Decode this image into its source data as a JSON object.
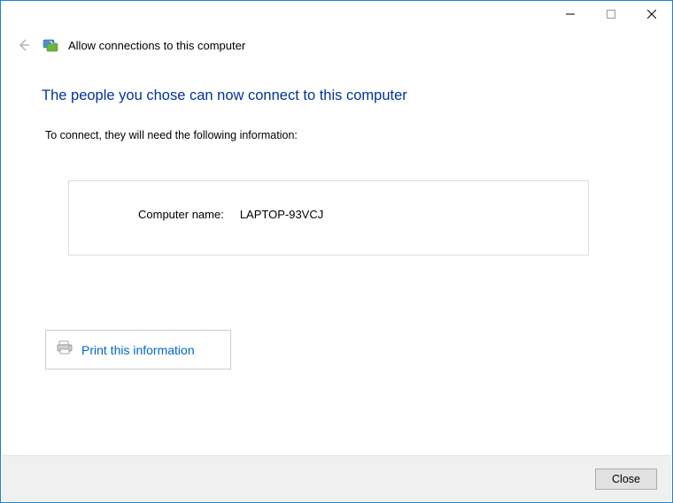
{
  "window": {
    "title": "Allow connections to this computer"
  },
  "main": {
    "heading": "The people you chose can now connect to this computer",
    "subtext": "To connect, they will need the following information:",
    "computer_name_label": "Computer name:",
    "computer_name_value": "LAPTOP-93VCJ",
    "print_label": "Print this information"
  },
  "footer": {
    "close_label": "Close"
  }
}
